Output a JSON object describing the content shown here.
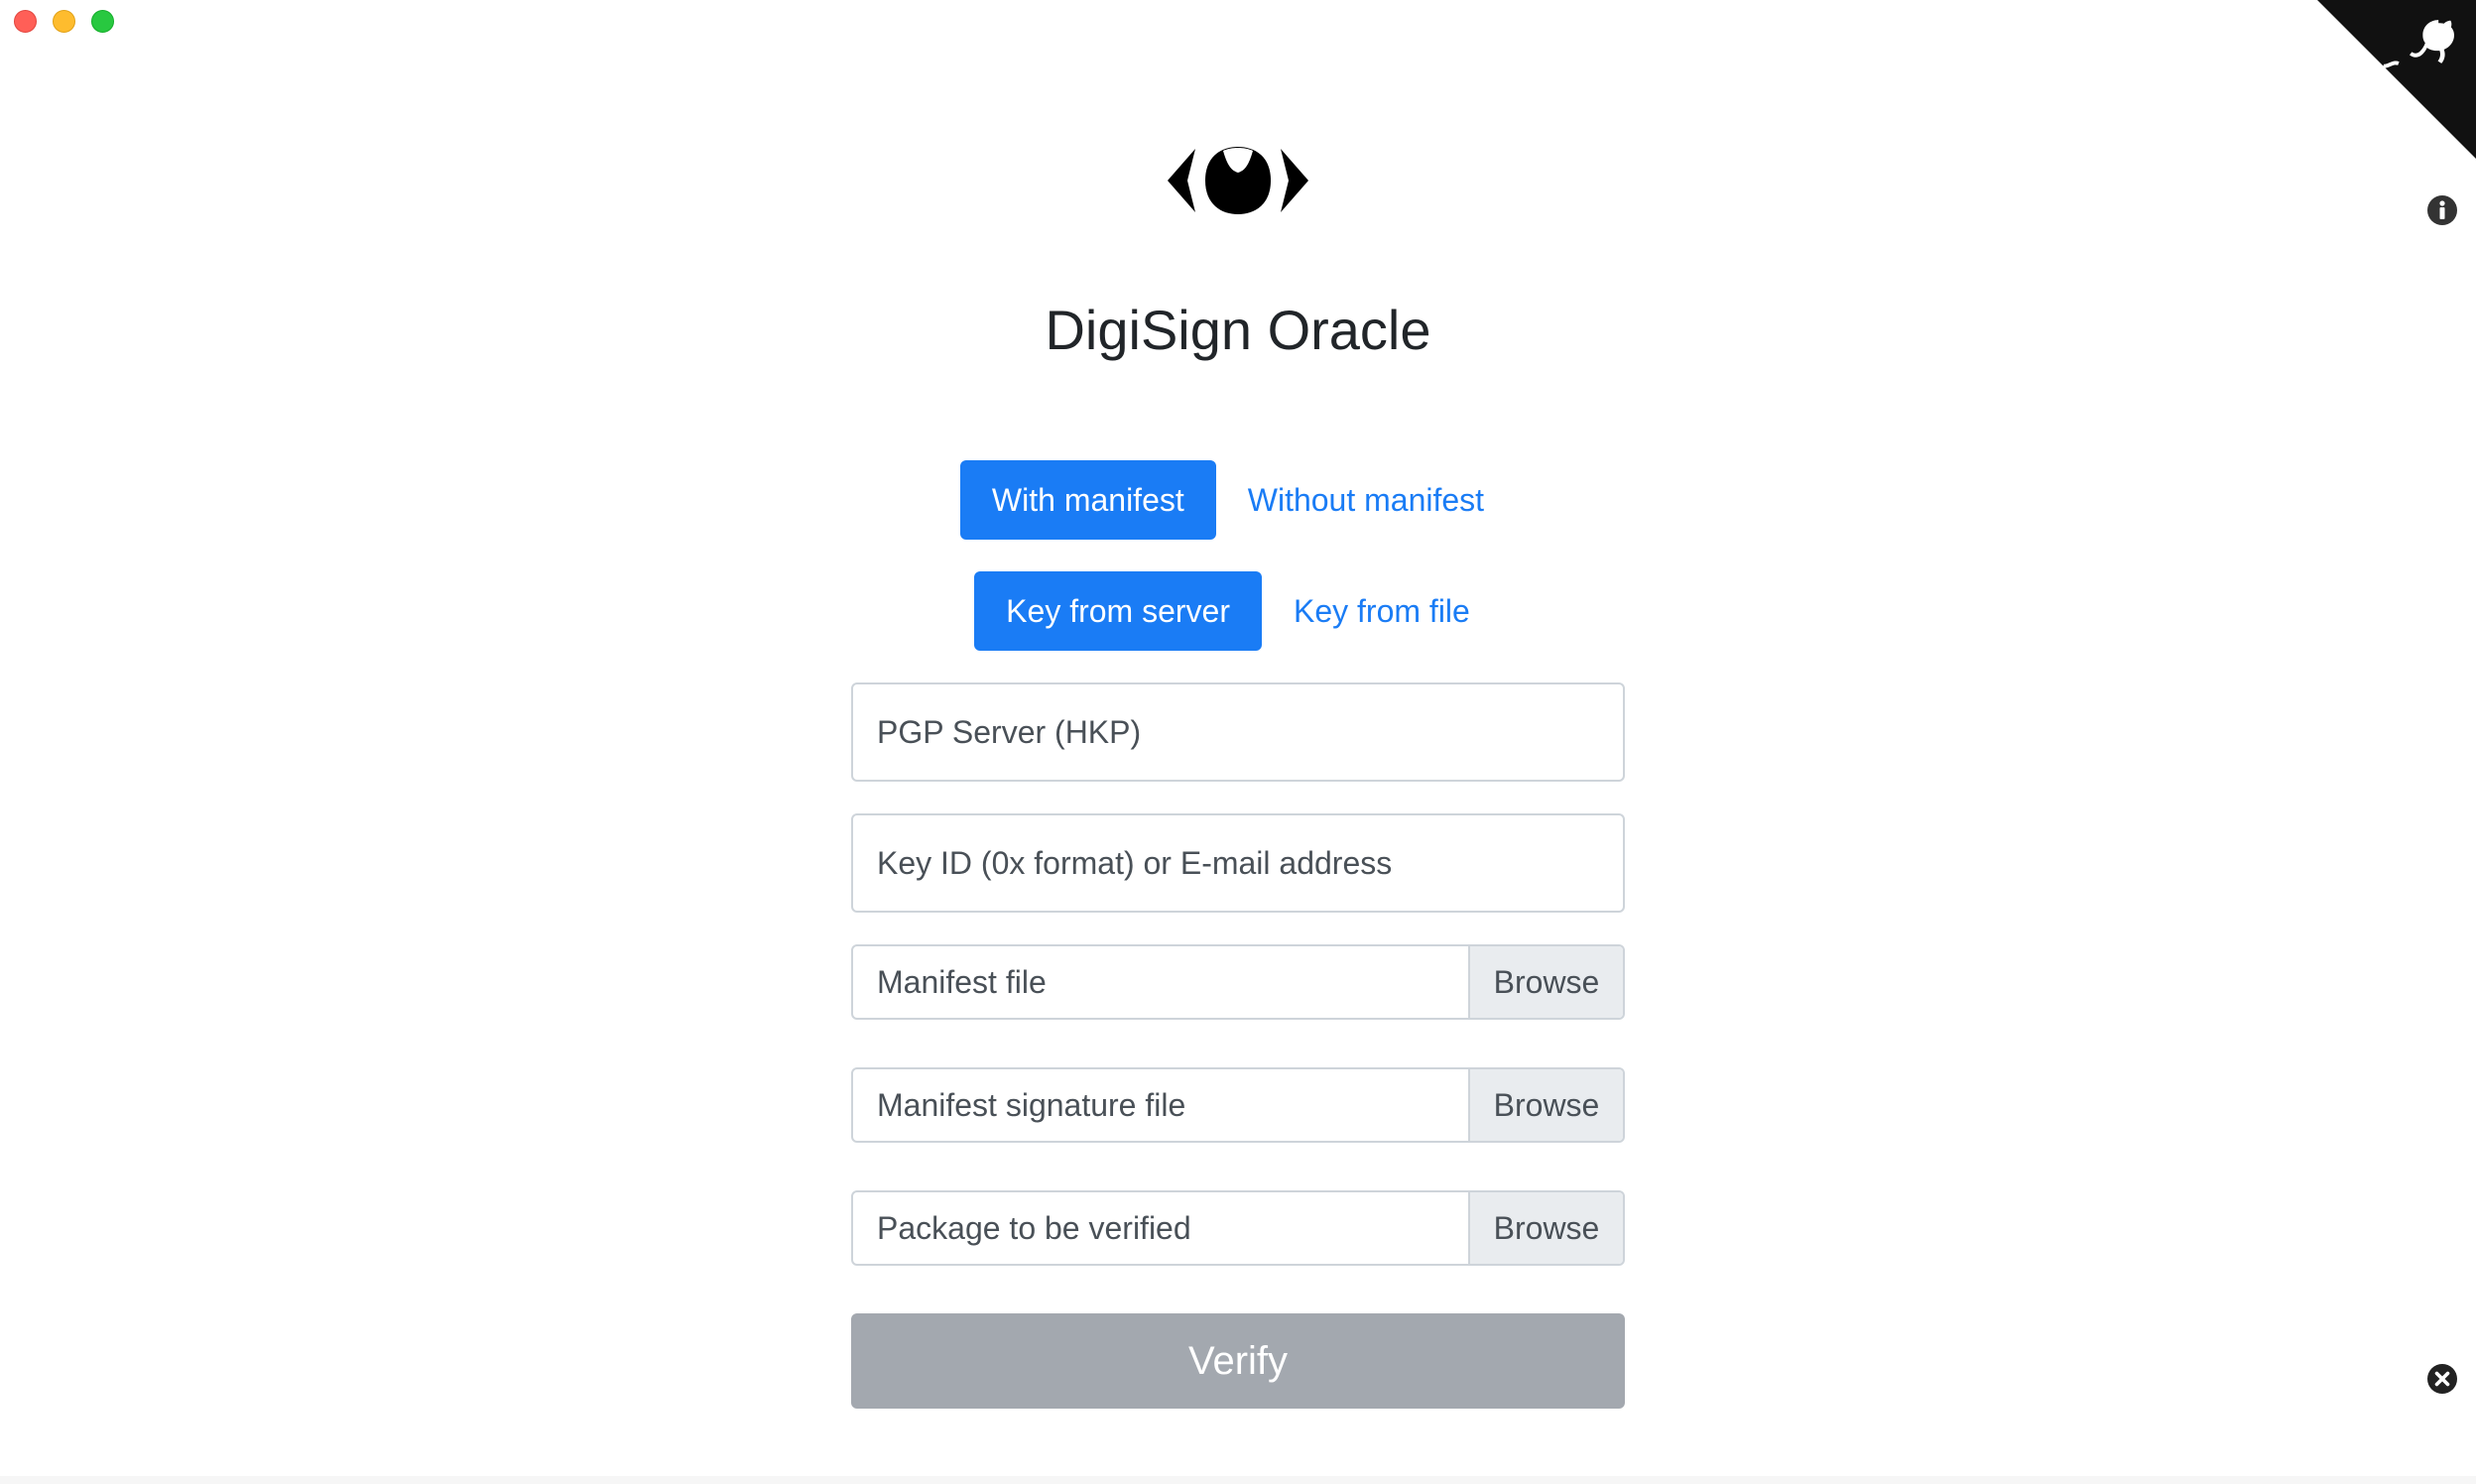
{
  "window": {
    "controls": [
      "close",
      "minimize",
      "maximize"
    ]
  },
  "header": {
    "title": "DigiSign Oracle",
    "logo_icon": "eye-icon"
  },
  "mode_tabs": [
    {
      "label": "With manifest",
      "active": true
    },
    {
      "label": "Without manifest",
      "active": false
    }
  ],
  "key_tabs": [
    {
      "label": "Key from server",
      "active": true
    },
    {
      "label": "Key from file",
      "active": false
    }
  ],
  "form": {
    "pgp_server_placeholder": "PGP Server (HKP)",
    "key_id_placeholder": "Key ID (0x format) or E-mail address",
    "manifest_file_label": "Manifest file",
    "manifest_signature_label": "Manifest signature file",
    "package_label": "Package to be verified",
    "browse_label": "Browse",
    "verify_label": "Verify"
  },
  "side_icons": {
    "info": "info-icon",
    "close": "close-circle-icon",
    "github": "github-octocat-icon"
  },
  "colors": {
    "accent": "#1a7cf5",
    "verify_disabled": "#a3a8af"
  }
}
